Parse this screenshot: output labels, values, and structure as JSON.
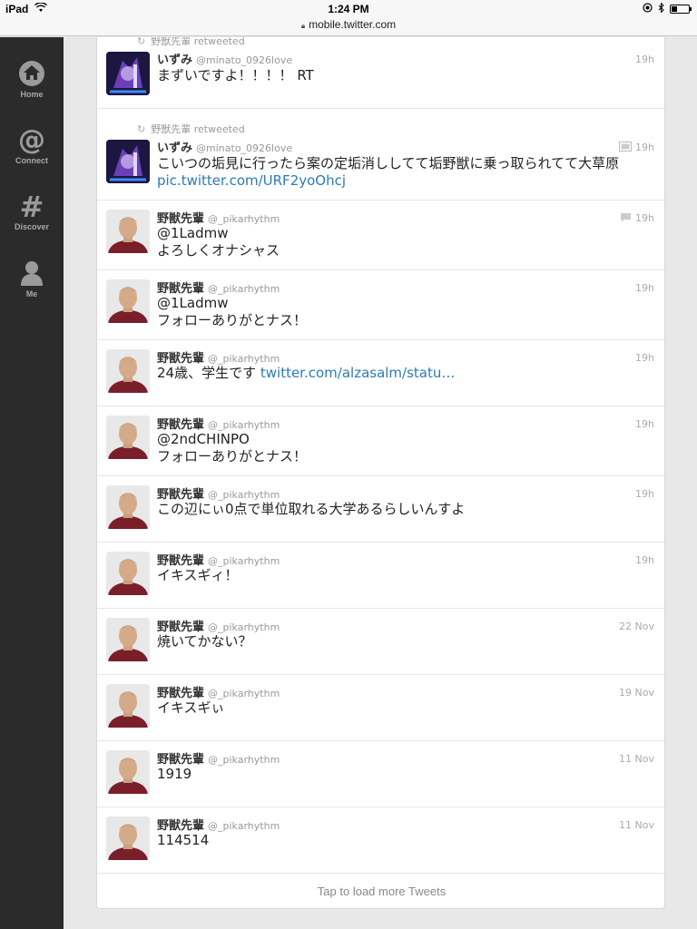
{
  "statusbar": {
    "device": "iPad",
    "time": "1:24 PM",
    "url": "mobile.twitter.com",
    "battery_level": 0.3
  },
  "sidebar": {
    "items": [
      {
        "label": "Home",
        "icon": "home-icon"
      },
      {
        "label": "Connect",
        "icon": "at-icon"
      },
      {
        "label": "Discover",
        "icon": "hash-icon"
      },
      {
        "label": "Me",
        "icon": "person-icon"
      }
    ]
  },
  "colors": {
    "link": "#2b7bb9",
    "sidebar": "#2b2b2b",
    "muted": "#999999"
  },
  "tweets": [
    {
      "retweeted_by": "野獣先輩 retweeted",
      "name": "いずみ",
      "handle": "@minato_0926love",
      "time": "19h",
      "lines": [
        "まずいですよ！！！！ RT"
      ],
      "link": ""
    },
    {
      "retweeted_by": "野獣先輩 retweeted",
      "name": "いずみ",
      "handle": "@minato_0926love",
      "time": "19h",
      "lines": [
        "こいつの垢見に行ったら案の定垢消ししてて垢野獣に乗っ取られてて大草原"
      ],
      "link": "pic.twitter.com/URF2yoOhcj"
    },
    {
      "name": "野獣先輩",
      "handle": "@_pikarhythm",
      "time": "19h",
      "lines": [
        "@1Ladmw",
        "よろしくオナシャス"
      ]
    },
    {
      "name": "野獣先輩",
      "handle": "@_pikarhythm",
      "time": "19h",
      "lines": [
        "@1Ladmw",
        "フォローありがとナス！"
      ]
    },
    {
      "name": "野獣先輩",
      "handle": "@_pikarhythm",
      "time": "19h",
      "lines": [
        "24歳、学生です"
      ],
      "link": "twitter.com/alzasalm/statu…"
    },
    {
      "name": "野獣先輩",
      "handle": "@_pikarhythm",
      "time": "19h",
      "lines": [
        "@2ndCHINPO",
        "フォローありがとナス！"
      ]
    },
    {
      "name": "野獣先輩",
      "handle": "@_pikarhythm",
      "time": "19h",
      "lines": [
        "この辺にぃ0点で単位取れる大学あるらしいんすよ"
      ]
    },
    {
      "name": "野獣先輩",
      "handle": "@_pikarhythm",
      "time": "19h",
      "lines": [
        "イキスギィ！"
      ]
    },
    {
      "name": "野獣先輩",
      "handle": "@_pikarhythm",
      "time": "22 Nov",
      "lines": [
        "焼いてかない？"
      ]
    },
    {
      "name": "野獣先輩",
      "handle": "@_pikarhythm",
      "time": "19 Nov",
      "lines": [
        "イキスギぃ"
      ]
    },
    {
      "name": "野獣先輩",
      "handle": "@_pikarhythm",
      "time": "11 Nov",
      "lines": [
        "1919"
      ]
    },
    {
      "name": "野獣先輩",
      "handle": "@_pikarhythm",
      "time": "11 Nov",
      "lines": [
        "114514"
      ]
    }
  ],
  "load_more": "Tap to load more Tweets"
}
